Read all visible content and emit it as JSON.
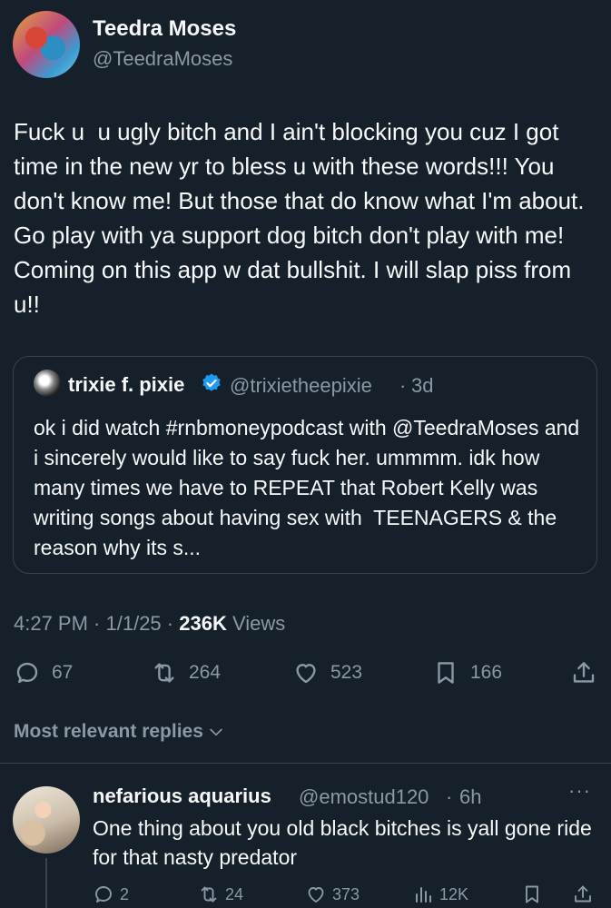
{
  "author": {
    "name": "Teedra Moses",
    "handle": "@TeedraMoses"
  },
  "tweet": {
    "text": "Fuck u  u ugly bitch and I ain't blocking you cuz I got time in the new yr to bless u with these words!!! You don't know me! But those that do know what I'm about. Go play with ya support dog bitch don't play with me! Coming on this app w dat bullshit. I will slap piss from u!!",
    "time": "4:27 PM",
    "date": "1/1/25",
    "views_count": "236K",
    "views_label": "Views"
  },
  "quote": {
    "name": "trixie f. pixie",
    "handle": "@trixietheepixie",
    "separator": "·",
    "time": "3d",
    "text": "ok i did watch #rnbmoneypodcast with @TeedraMoses and i sincerely would like to say fuck her. ummmm. idk how many times we have to REPEAT that Robert Kelly was writing songs about having sex with  TEENAGERS & the reason why its s..."
  },
  "actions": {
    "replies": "67",
    "reposts": "264",
    "likes": "523",
    "bookmarks": "166"
  },
  "replies_sort": {
    "label": "Most relevant replies"
  },
  "reply": {
    "name": "nefarious aquarius",
    "handle": "@emostud120",
    "separator": "·",
    "time": "6h",
    "more": "···",
    "text": "One thing about you old black bitches is yall gone ride for that nasty predator",
    "replies": "2",
    "reposts": "24",
    "likes": "373",
    "views": "12K"
  },
  "icons": {
    "reply": "speech-bubble-icon",
    "repost": "repost-arrows-icon",
    "like": "heart-icon",
    "bookmark": "bookmark-icon",
    "share": "share-upload-icon",
    "views": "bar-chart-icon",
    "verified": "verified-badge-icon",
    "chevron": "chevron-down-icon"
  },
  "colors": {
    "background": "#15202b",
    "text": "#f7f9f9",
    "secondary": "#8b98a5",
    "border": "#38444d",
    "verified": "#1d9bf0"
  }
}
